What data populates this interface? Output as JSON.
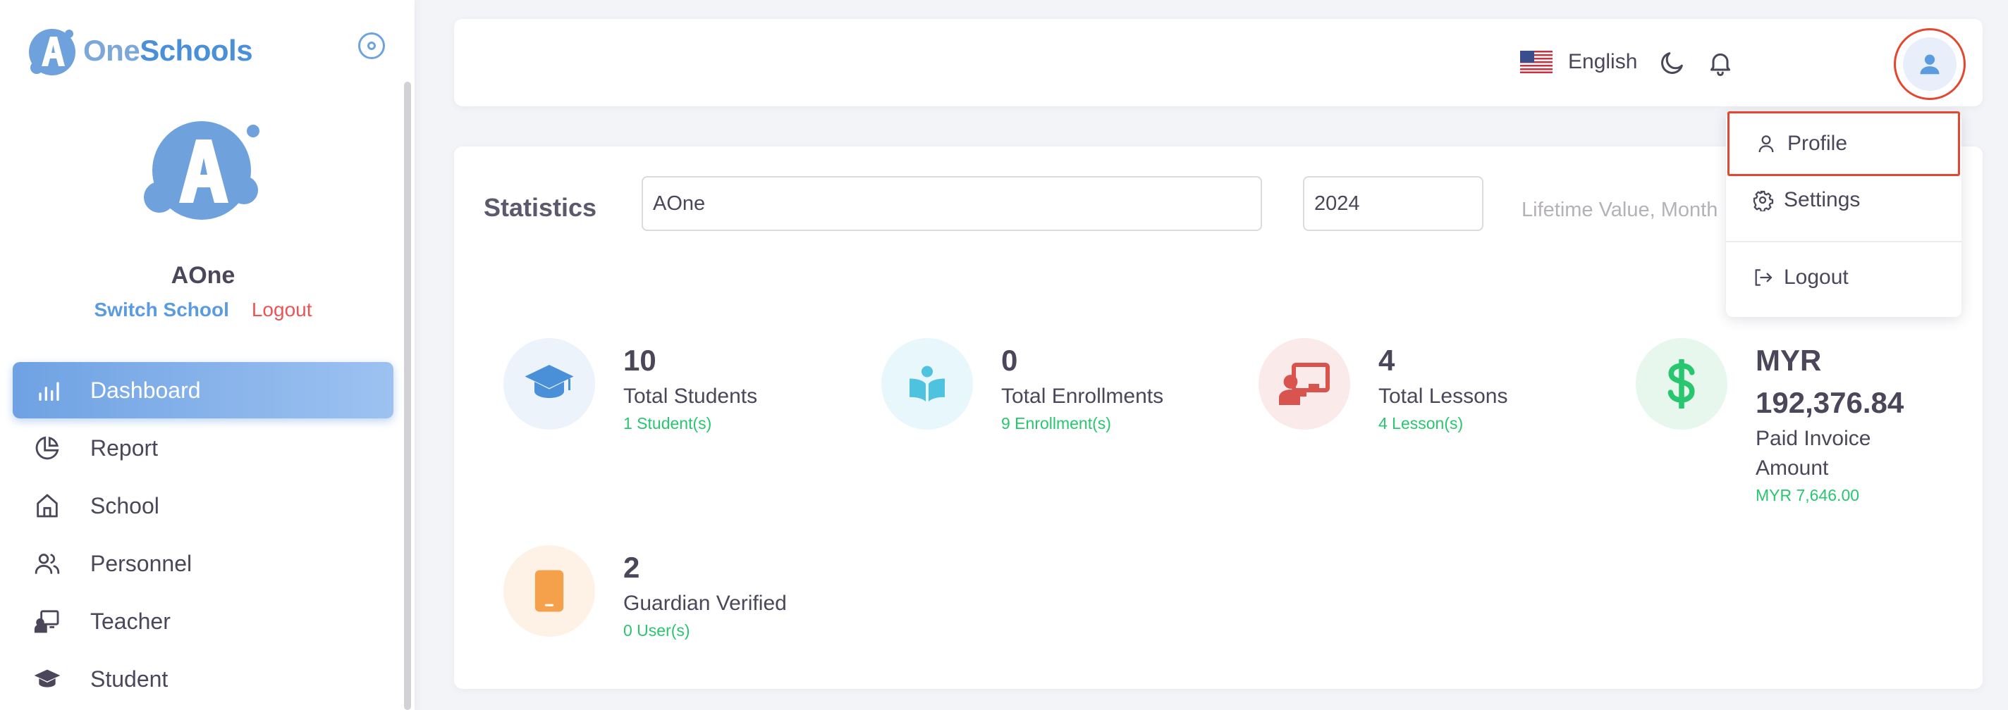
{
  "brand": {
    "name_part1": "One",
    "name_part2": "Schools"
  },
  "school": {
    "name": "AOne",
    "switch_label": "Switch School",
    "logout_label": "Logout"
  },
  "nav": {
    "items": [
      {
        "label": "Dashboard",
        "icon": "chart-bar-icon",
        "active": true
      },
      {
        "label": "Report",
        "icon": "chart-pie-icon"
      },
      {
        "label": "School",
        "icon": "home-icon"
      },
      {
        "label": "Personnel",
        "icon": "users-icon"
      },
      {
        "label": "Teacher",
        "icon": "teacher-icon"
      },
      {
        "label": "Student",
        "icon": "graduation-cap-icon"
      }
    ]
  },
  "header": {
    "language": "English",
    "language_flag": "us-flag-icon"
  },
  "statistics": {
    "title": "Statistics",
    "school_select": "AOne",
    "year_select": "2024",
    "filter_text": "Lifetime Value, Month",
    "cards": [
      {
        "value": "10",
        "label": "Total Students",
        "sub": "1 Student(s)",
        "icon": "graduation-cap-icon",
        "color": "#4a90d9",
        "bg": "#edf3fb"
      },
      {
        "value": "0",
        "label": "Total Enrollments",
        "sub": "9 Enrollment(s)",
        "icon": "book-reader-icon",
        "color": "#4fc2df",
        "bg": "#e8f7fb"
      },
      {
        "value": "4",
        "label": "Total Lessons",
        "sub": "4 Lesson(s)",
        "icon": "teacher-board-icon",
        "color": "#d9534f",
        "bg": "#fbeaea"
      },
      {
        "value_line1": "MYR",
        "value_line2": "192,376.84",
        "label_line1": "Paid Invoice",
        "label_line2": "Amount",
        "sub": "MYR 7,646.00",
        "icon": "dollar-icon",
        "color": "#28c76f",
        "bg": "#e8f7ee"
      },
      {
        "value": "2",
        "label": "Guardian Verified",
        "sub": "0 User(s)",
        "icon": "mobile-phone-icon",
        "color": "#f5a04a",
        "bg": "#fef2e6"
      }
    ]
  },
  "user_menu": {
    "profile": "Profile",
    "settings": "Settings",
    "logout": "Logout"
  }
}
